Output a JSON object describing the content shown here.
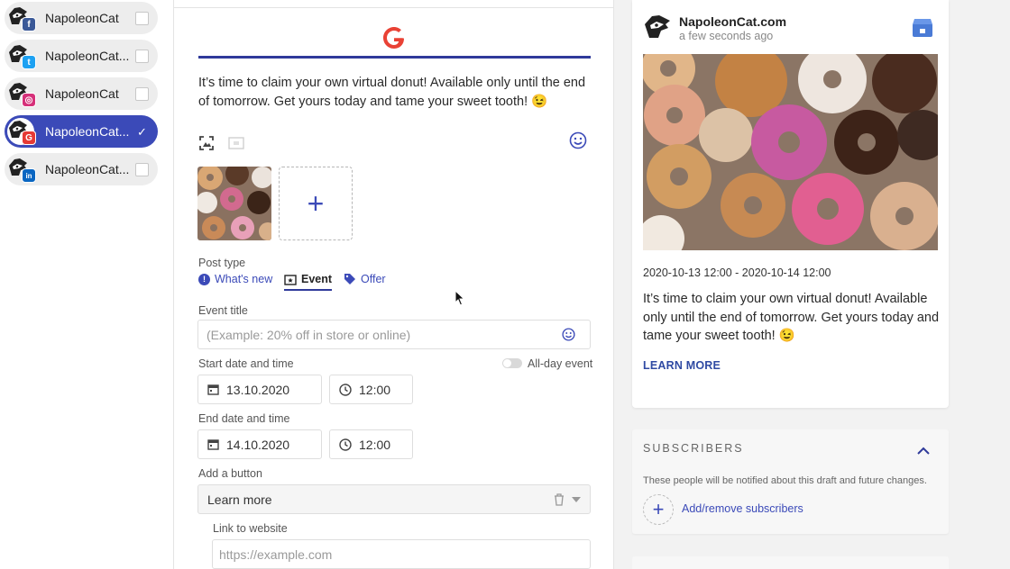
{
  "accounts": [
    {
      "name": "NapoleonCat",
      "network": "facebook",
      "badge_letter": "f",
      "badge_color": "#3b5998",
      "selected": false
    },
    {
      "name": "NapoleonCat...",
      "network": "twitter",
      "badge_letter": "t",
      "badge_color": "#1da1f2",
      "selected": false
    },
    {
      "name": "NapoleonCat",
      "network": "instagram",
      "badge_letter": "◎",
      "badge_color": "#d6317a",
      "selected": false
    },
    {
      "name": "NapoleonCat...",
      "network": "google",
      "badge_letter": "G",
      "badge_color": "#e53935",
      "selected": true
    },
    {
      "name": "NapoleonCat...",
      "network": "linkedin",
      "badge_letter": "in",
      "badge_color": "#0a66c2",
      "selected": false
    }
  ],
  "colors": {
    "accent": "#3b4ab8",
    "selected_account": "#3b4ab8",
    "google_red": "#e94235"
  },
  "editor": {
    "post_text": "It’s time to claim your own virtual donut! Available only until the end of tomorrow. Get yours today and tame your sweet tooth! 😉",
    "post_type_label": "Post type",
    "post_types": [
      "What's new",
      "Event",
      "Offer"
    ],
    "post_type_selected": "Event",
    "event_title_label": "Event title",
    "event_title_placeholder": "(Example: 20% off in store or online)",
    "start_label": "Start date and time",
    "allday_label": "All-day event",
    "start_date": "13.10.2020",
    "start_time": "12:00",
    "end_label": "End date and time",
    "end_date": "14.10.2020",
    "end_time": "12:00",
    "button_label": "Add a button",
    "button_value": "Learn more",
    "link_label": "Link to website",
    "link_placeholder": "https://example.com"
  },
  "preview": {
    "name": "NapoleonCat.com",
    "time": "a few seconds ago",
    "dates": "2020-10-13 12:00 - 2020-10-14 12:00",
    "text": "It’s time to claim your own virtual donut! Available only until the end of tomorrow. Get yours today and tame your sweet tooth! 😉",
    "cta": "LEARN MORE"
  },
  "subscribers": {
    "title": "SUBSCRIBERS",
    "note": "These people will be notified about this draft and future changes.",
    "add_label": "Add/remove subscribers"
  }
}
